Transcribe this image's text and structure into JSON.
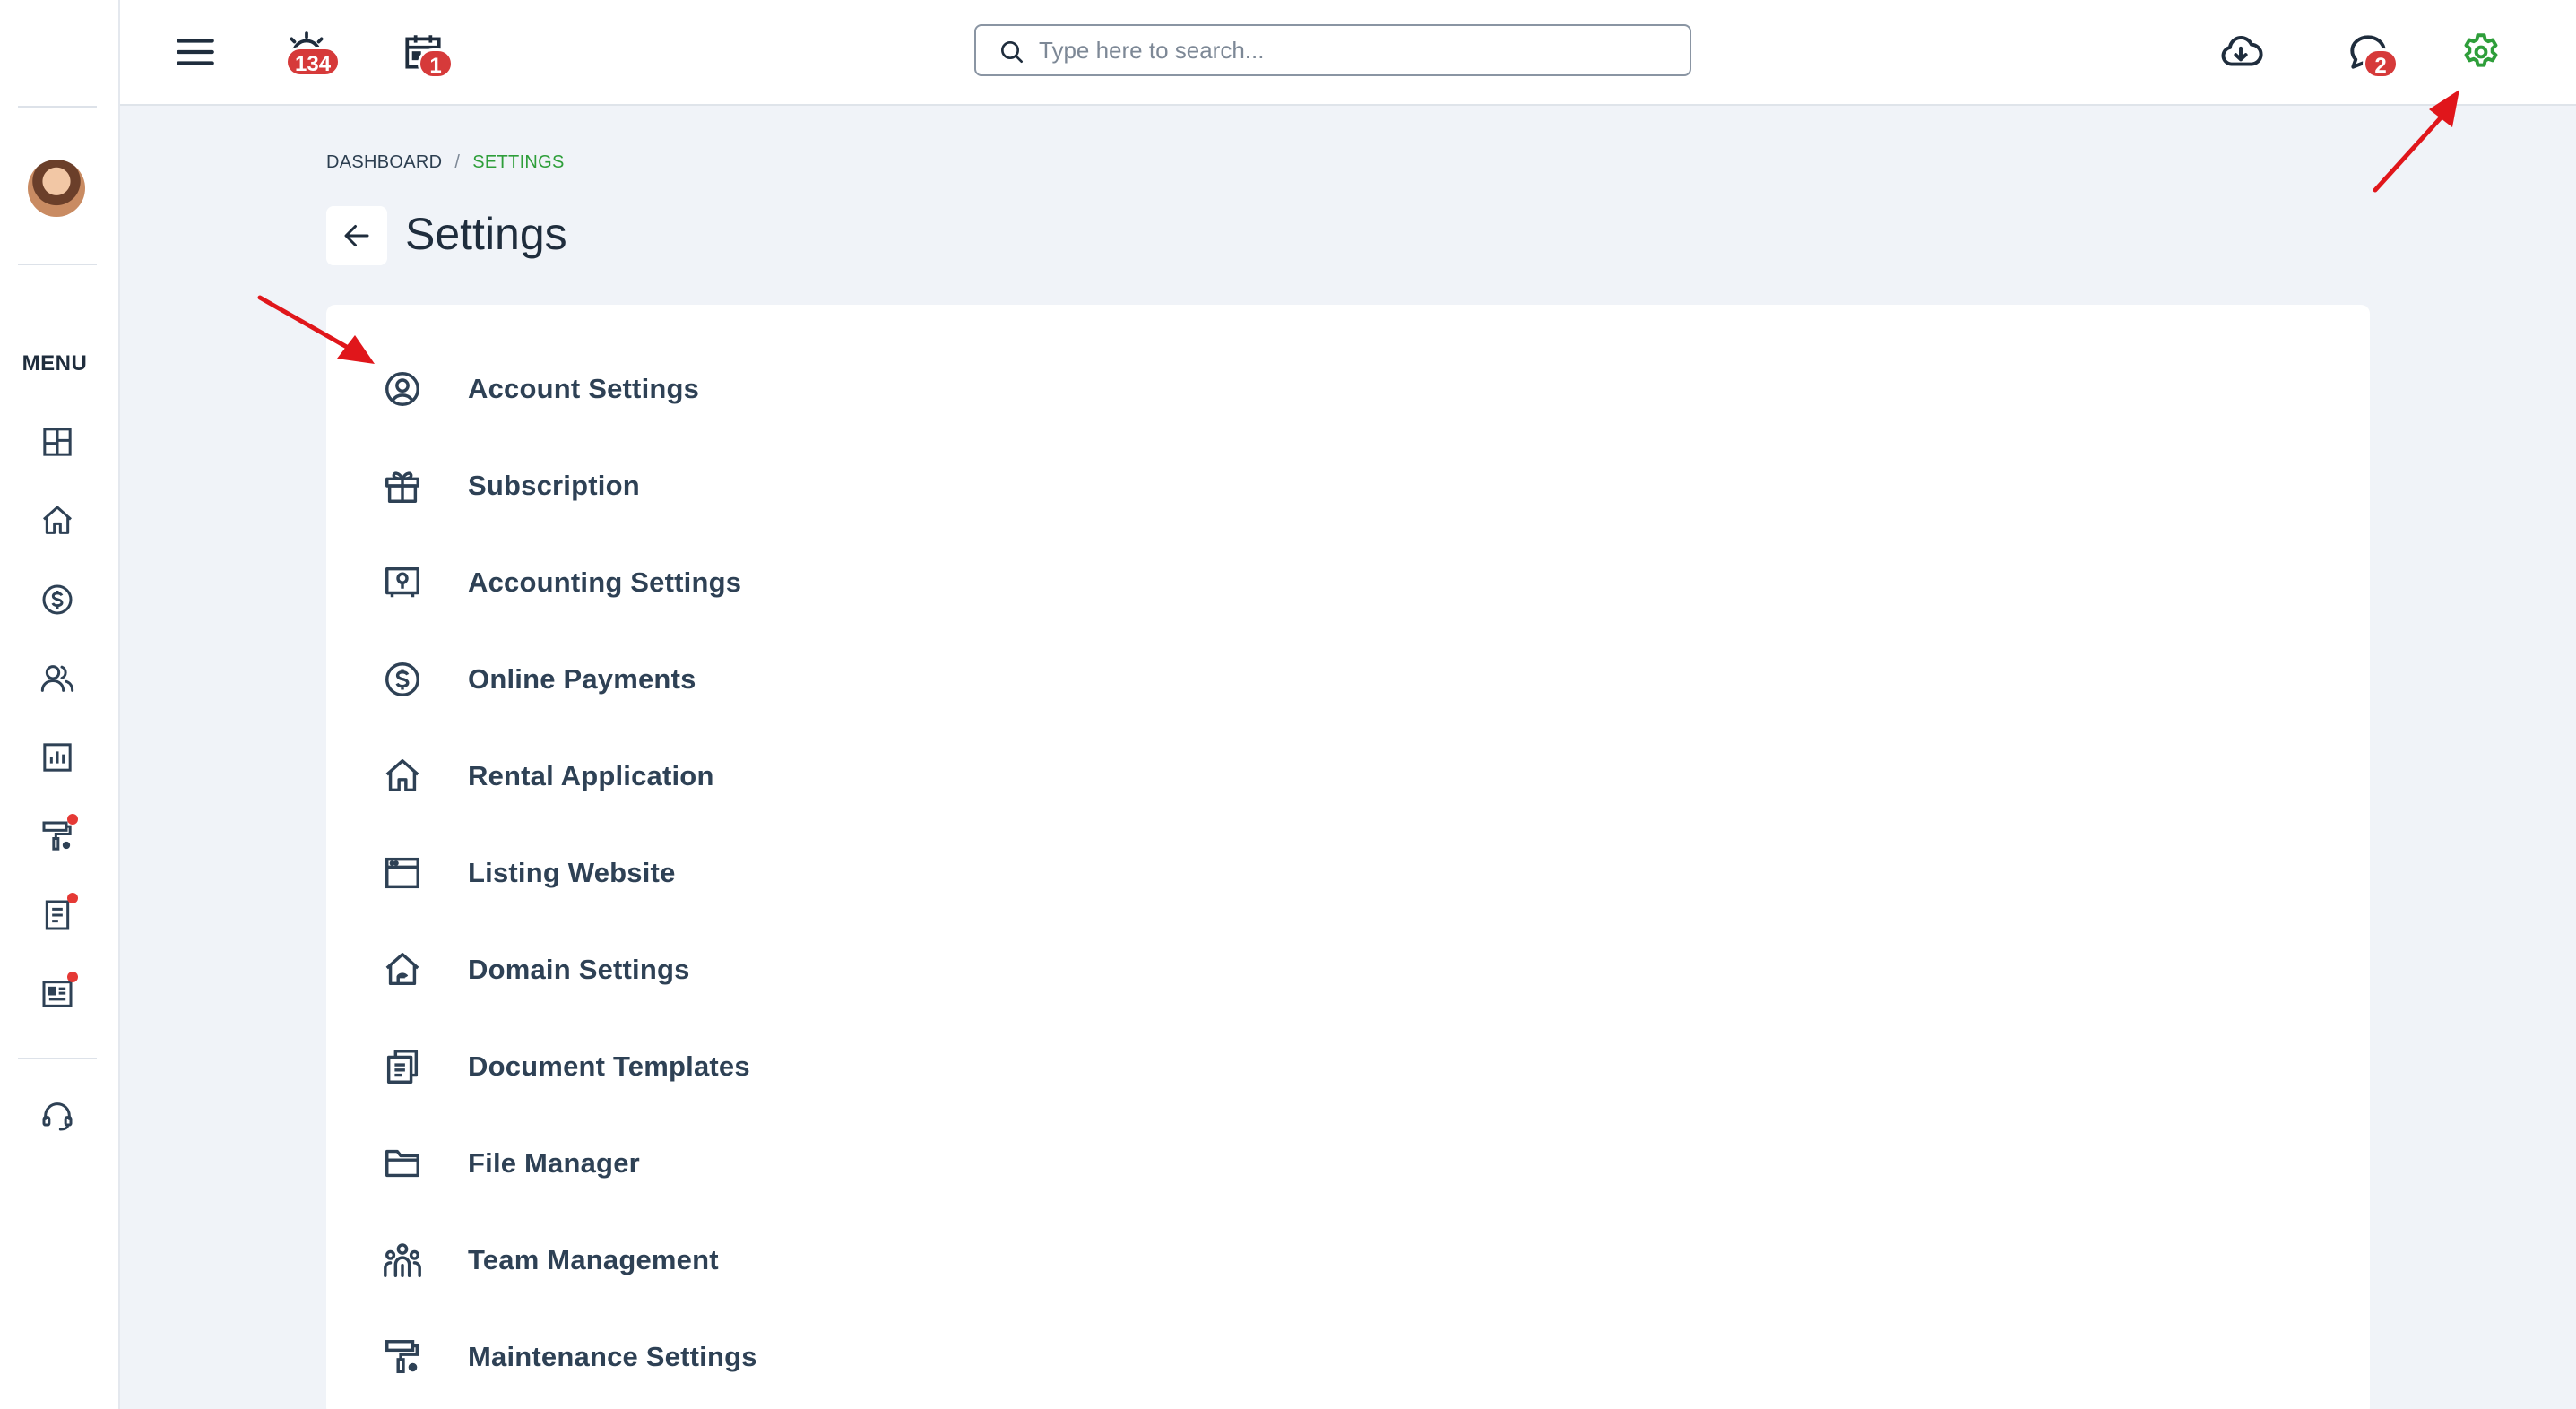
{
  "topbar": {
    "alerts_badge": "134",
    "calendar_badge": "1",
    "messages_badge": "2",
    "search_placeholder": "Type here to search..."
  },
  "sidebar": {
    "menu_label": "MENU",
    "items": [
      {
        "icon": "dashboard-grid-icon",
        "has_dot": false
      },
      {
        "icon": "home-icon",
        "has_dot": false
      },
      {
        "icon": "dollar-circle-icon",
        "has_dot": false
      },
      {
        "icon": "users-icon",
        "has_dot": false
      },
      {
        "icon": "chart-icon",
        "has_dot": false
      },
      {
        "icon": "paint-roller-icon",
        "has_dot": true
      },
      {
        "icon": "document-icon",
        "has_dot": true
      },
      {
        "icon": "news-icon",
        "has_dot": true
      }
    ],
    "support_icon": "headset-icon"
  },
  "breadcrumb": {
    "root": "DASHBOARD",
    "separator": "/",
    "current": "SETTINGS"
  },
  "page": {
    "title": "Settings"
  },
  "settings": [
    {
      "label": "Account Settings",
      "icon": "user-circle-icon"
    },
    {
      "label": "Subscription",
      "icon": "gift-icon"
    },
    {
      "label": "Accounting Settings",
      "icon": "accounting-icon"
    },
    {
      "label": "Online Payments",
      "icon": "dollar-circle-icon"
    },
    {
      "label": "Rental Application",
      "icon": "home-icon"
    },
    {
      "label": "Listing Website",
      "icon": "browser-window-icon"
    },
    {
      "label": "Domain Settings",
      "icon": "domain-home-icon"
    },
    {
      "label": "Document Templates",
      "icon": "documents-icon"
    },
    {
      "label": "File Manager",
      "icon": "folder-icon"
    },
    {
      "label": "Team Management",
      "icon": "team-icon"
    },
    {
      "label": "Maintenance Settings",
      "icon": "paint-roller-icon"
    }
  ],
  "colors": {
    "accent_green": "#2e9e3a",
    "badge_red": "#d63a3a",
    "annotation_arrow": "#e0161b",
    "text_dark": "#2e4155"
  }
}
